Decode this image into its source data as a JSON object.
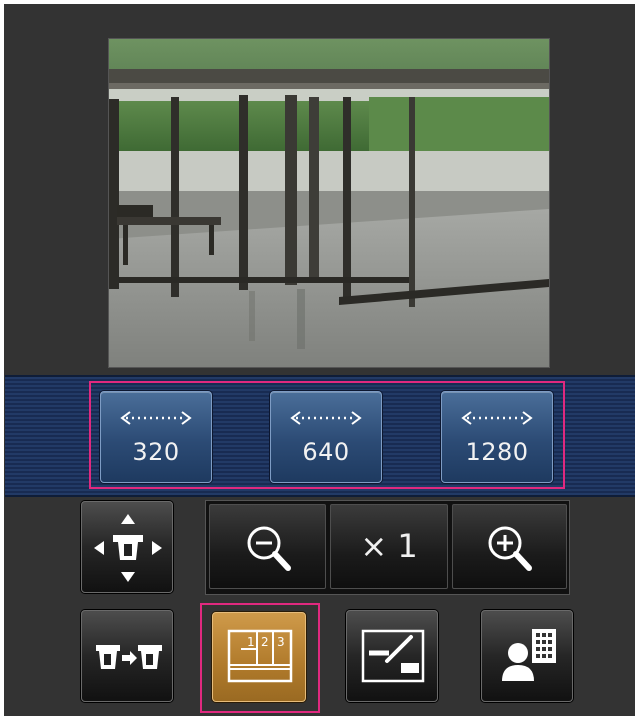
{
  "resolution_buttons": [
    {
      "label": "320"
    },
    {
      "label": "640"
    },
    {
      "label": "1280"
    }
  ],
  "zoom": {
    "level_label": "× 1"
  },
  "icons": {
    "pan_tilt": "pan-tilt-arrows-icon",
    "zoom_out": "zoom-out-magnifier-icon",
    "zoom_in": "zoom-in-magnifier-icon",
    "camera_switch": "camera-to-camera-icon",
    "multi_screen": "multi-screen-layout-icon",
    "brightness": "brightness-adjust-icon",
    "preset": "user-preset-icon"
  },
  "multi_screen_digits": {
    "first": "1",
    "second": "2",
    "third": "3"
  },
  "colors": {
    "highlight": "#e0297f",
    "resolution_bar": "#223a66",
    "active_button": "#b07a2b",
    "background": "#333333"
  }
}
